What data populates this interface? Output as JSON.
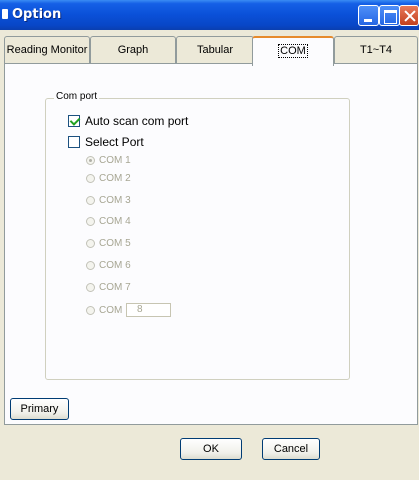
{
  "window": {
    "title": "Option"
  },
  "tabs": [
    {
      "label": "Reading Monitor"
    },
    {
      "label": "Graph"
    },
    {
      "label": "Tabular"
    },
    {
      "label": "COM"
    },
    {
      "label": "T1~T4"
    }
  ],
  "com_group": {
    "title": "Com port",
    "auto_scan": {
      "label": "Auto scan  com port",
      "checked": true
    },
    "select_port": {
      "label": "Select Port",
      "checked": false
    },
    "ports": [
      {
        "label": "COM 1",
        "selected": true
      },
      {
        "label": "COM 2",
        "selected": false
      },
      {
        "label": "COM 3",
        "selected": false
      },
      {
        "label": "COM 4",
        "selected": false
      },
      {
        "label": "COM 5",
        "selected": false
      },
      {
        "label": "COM 6",
        "selected": false
      },
      {
        "label": "COM 7",
        "selected": false
      },
      {
        "label": "COM",
        "selected": false
      }
    ],
    "custom_port_value": "8"
  },
  "buttons": {
    "primary": "Primary",
    "ok": "OK",
    "cancel": "Cancel"
  }
}
